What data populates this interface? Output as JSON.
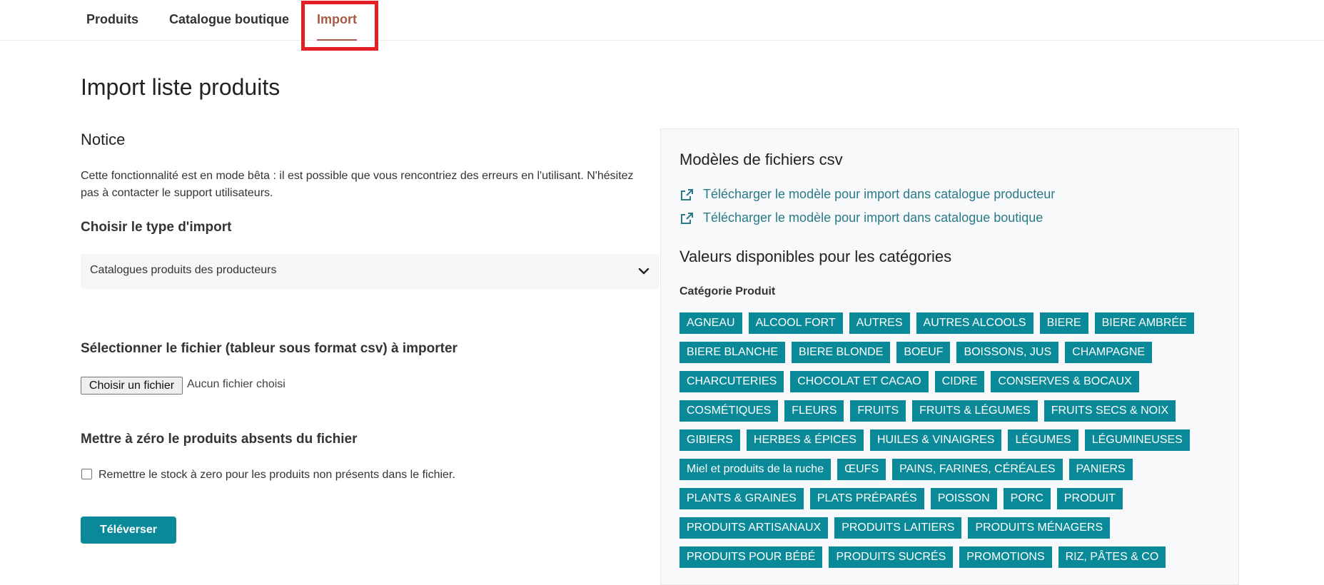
{
  "tabs": [
    {
      "label": "Produits"
    },
    {
      "label": "Catalogue boutique"
    },
    {
      "label": "Import"
    }
  ],
  "page": {
    "title": "Import liste produits",
    "notice_heading": "Notice",
    "notice_text": "Cette fonctionnalité est en mode bêta : il est possible que vous rencontriez des erreurs en l'utilisant. N'hésitez pas à contacter le support utilisateurs.",
    "import_type_heading": "Choisir le type d'import",
    "import_type_value": "Catalogues produits des producteurs",
    "file_heading": "Sélectionner le fichier (tableur sous format csv) à importer",
    "file_button": "Choisir un fichier",
    "file_status": "Aucun fichier choisi",
    "reset_heading": "Mettre à zéro le produits absents du fichier",
    "reset_checkbox_label": "Remettre le stock à zero pour les produits non présents dans le fichier.",
    "upload_button": "Téléverser"
  },
  "panel": {
    "models_heading": "Modèles de fichiers csv",
    "links": [
      "Télécharger le modèle pour import dans catalogue producteur",
      "Télécharger le modèle pour import dans catalogue boutique"
    ],
    "categories_heading": "Valeurs disponibles pour les catégories",
    "category_label": "Catégorie Produit",
    "tag_rows": [
      [
        "AGNEAU",
        "ALCOOL FORT",
        "AUTRES",
        "AUTRES ALCOOLS",
        "BIERE",
        "BIERE AMBRÉE"
      ],
      [
        "BIERE BLANCHE",
        "BIERE BLONDE",
        "BOEUF",
        "BOISSONS, JUS",
        "CHAMPAGNE"
      ],
      [
        "CHARCUTERIES",
        "CHOCOLAT ET CACAO",
        "CIDRE",
        "CONSERVES & BOCAUX"
      ],
      [
        "COSMÉTIQUES",
        "FLEURS",
        "FRUITS",
        "FRUITS & LÉGUMES",
        "FRUITS SECS & NOIX"
      ],
      [
        "GIBIERS",
        "HERBES & ÉPICES",
        "HUILES & VINAIGRES",
        "LÉGUMES",
        "LÉGUMINEUSES"
      ],
      [
        "Miel et produits de la ruche",
        "ŒUFS",
        "PAINS, FARINES, CÉRÉALES",
        "PANIERS"
      ],
      [
        "PLANTS & GRAINES",
        "PLATS PRÉPARÉS",
        "POISSON",
        "PORC",
        "PRODUIT"
      ],
      [
        "PRODUITS ARTISANAUX",
        "PRODUITS LAITIERS",
        "PRODUITS MÉNAGERS"
      ],
      [
        "PRODUITS POUR BÉBÉ",
        "PRODUITS SUCRÉS",
        "PROMOTIONS",
        "RIZ, PÂTES & CO"
      ]
    ]
  },
  "colors": {
    "accent": "#0a8a99",
    "active_tab": "#a65a46",
    "link": "#2b7a88",
    "highlight": "#e31e24"
  }
}
